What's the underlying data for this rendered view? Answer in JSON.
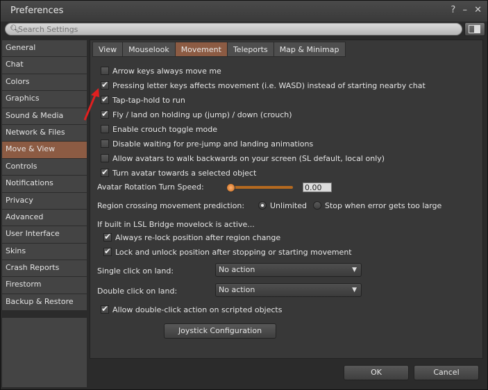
{
  "window": {
    "title": "Preferences",
    "controls": [
      "?",
      "–",
      "✕"
    ]
  },
  "search": {
    "placeholder": "Search Settings"
  },
  "sidebar": {
    "items": [
      {
        "label": "General"
      },
      {
        "label": "Chat"
      },
      {
        "label": "Colors"
      },
      {
        "label": "Graphics"
      },
      {
        "label": "Sound & Media"
      },
      {
        "label": "Network & Files"
      },
      {
        "label": "Move & View",
        "active": true
      },
      {
        "label": "Controls"
      },
      {
        "label": "Notifications"
      },
      {
        "label": "Privacy"
      },
      {
        "label": "Advanced"
      },
      {
        "label": "User Interface"
      },
      {
        "label": "Skins"
      },
      {
        "label": "Crash Reports"
      },
      {
        "label": "Firestorm"
      },
      {
        "label": "Backup & Restore"
      }
    ]
  },
  "tabs": [
    {
      "label": "View"
    },
    {
      "label": "Mouselook"
    },
    {
      "label": "Movement",
      "active": true
    },
    {
      "label": "Teleports"
    },
    {
      "label": "Map & Minimap"
    }
  ],
  "movement": {
    "checkboxes": [
      {
        "label": "Arrow keys always move me",
        "checked": false
      },
      {
        "label": "Pressing letter keys affects movement (i.e. WASD) instead of starting nearby chat",
        "checked": true
      },
      {
        "label": "Tap-tap-hold to run",
        "checked": true
      },
      {
        "label": "Fly / land on holding up (jump) / down (crouch)",
        "checked": true
      },
      {
        "label": "Enable crouch toggle mode",
        "checked": false
      },
      {
        "label": "Disable waiting for pre-jump and landing animations",
        "checked": false
      },
      {
        "label": "Allow avatars to walk backwards on your screen (SL default, local only)",
        "checked": false
      },
      {
        "label": "Turn avatar towards a selected object",
        "checked": true
      }
    ],
    "rotation_speed_label": "Avatar Rotation Turn Speed:",
    "rotation_speed_value": "0.00",
    "rotation_speed_level": 0,
    "region_label": "Region crossing movement prediction:",
    "region_options": [
      {
        "label": "Unlimited",
        "selected": true
      },
      {
        "label": "Stop when error gets too large",
        "selected": false
      }
    ],
    "lsl_label": "If built in LSL Bridge movelock is active...",
    "lsl_checkboxes": [
      {
        "label": "Always re-lock position after region change",
        "checked": true
      },
      {
        "label": "Lock and unlock position after stopping or starting movement",
        "checked": true
      }
    ],
    "single_click_label": "Single click on land:",
    "single_click_value": "No action",
    "double_click_label": "Double click on land:",
    "double_click_value": "No action",
    "allow_dblclick_label": "Allow double-click action on scripted objects",
    "allow_dblclick_checked": true,
    "joystick_button": "Joystick Configuration"
  },
  "footer": {
    "ok": "OK",
    "cancel": "Cancel"
  },
  "colors": {
    "accent": "#8c5b43",
    "slider": "#b56a20",
    "annotation": "#e02020"
  }
}
